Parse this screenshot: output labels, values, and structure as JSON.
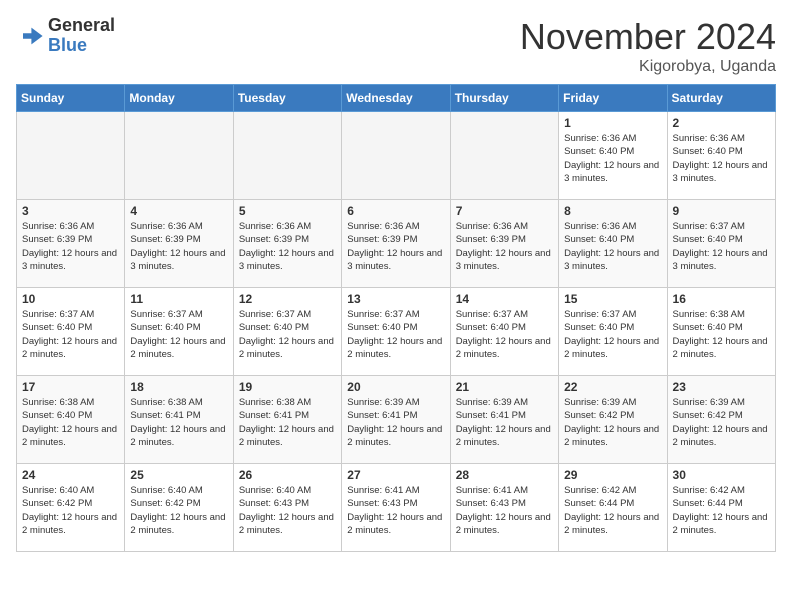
{
  "header": {
    "logo_line1": "General",
    "logo_line2": "Blue",
    "month": "November 2024",
    "location": "Kigorobya, Uganda"
  },
  "weekdays": [
    "Sunday",
    "Monday",
    "Tuesday",
    "Wednesday",
    "Thursday",
    "Friday",
    "Saturday"
  ],
  "weeks": [
    [
      {
        "day": "",
        "info": ""
      },
      {
        "day": "",
        "info": ""
      },
      {
        "day": "",
        "info": ""
      },
      {
        "day": "",
        "info": ""
      },
      {
        "day": "",
        "info": ""
      },
      {
        "day": "1",
        "info": "Sunrise: 6:36 AM\nSunset: 6:40 PM\nDaylight: 12 hours and 3 minutes."
      },
      {
        "day": "2",
        "info": "Sunrise: 6:36 AM\nSunset: 6:40 PM\nDaylight: 12 hours and 3 minutes."
      }
    ],
    [
      {
        "day": "3",
        "info": "Sunrise: 6:36 AM\nSunset: 6:39 PM\nDaylight: 12 hours and 3 minutes."
      },
      {
        "day": "4",
        "info": "Sunrise: 6:36 AM\nSunset: 6:39 PM\nDaylight: 12 hours and 3 minutes."
      },
      {
        "day": "5",
        "info": "Sunrise: 6:36 AM\nSunset: 6:39 PM\nDaylight: 12 hours and 3 minutes."
      },
      {
        "day": "6",
        "info": "Sunrise: 6:36 AM\nSunset: 6:39 PM\nDaylight: 12 hours and 3 minutes."
      },
      {
        "day": "7",
        "info": "Sunrise: 6:36 AM\nSunset: 6:39 PM\nDaylight: 12 hours and 3 minutes."
      },
      {
        "day": "8",
        "info": "Sunrise: 6:36 AM\nSunset: 6:40 PM\nDaylight: 12 hours and 3 minutes."
      },
      {
        "day": "9",
        "info": "Sunrise: 6:37 AM\nSunset: 6:40 PM\nDaylight: 12 hours and 3 minutes."
      }
    ],
    [
      {
        "day": "10",
        "info": "Sunrise: 6:37 AM\nSunset: 6:40 PM\nDaylight: 12 hours and 2 minutes."
      },
      {
        "day": "11",
        "info": "Sunrise: 6:37 AM\nSunset: 6:40 PM\nDaylight: 12 hours and 2 minutes."
      },
      {
        "day": "12",
        "info": "Sunrise: 6:37 AM\nSunset: 6:40 PM\nDaylight: 12 hours and 2 minutes."
      },
      {
        "day": "13",
        "info": "Sunrise: 6:37 AM\nSunset: 6:40 PM\nDaylight: 12 hours and 2 minutes."
      },
      {
        "day": "14",
        "info": "Sunrise: 6:37 AM\nSunset: 6:40 PM\nDaylight: 12 hours and 2 minutes."
      },
      {
        "day": "15",
        "info": "Sunrise: 6:37 AM\nSunset: 6:40 PM\nDaylight: 12 hours and 2 minutes."
      },
      {
        "day": "16",
        "info": "Sunrise: 6:38 AM\nSunset: 6:40 PM\nDaylight: 12 hours and 2 minutes."
      }
    ],
    [
      {
        "day": "17",
        "info": "Sunrise: 6:38 AM\nSunset: 6:40 PM\nDaylight: 12 hours and 2 minutes."
      },
      {
        "day": "18",
        "info": "Sunrise: 6:38 AM\nSunset: 6:41 PM\nDaylight: 12 hours and 2 minutes."
      },
      {
        "day": "19",
        "info": "Sunrise: 6:38 AM\nSunset: 6:41 PM\nDaylight: 12 hours and 2 minutes."
      },
      {
        "day": "20",
        "info": "Sunrise: 6:39 AM\nSunset: 6:41 PM\nDaylight: 12 hours and 2 minutes."
      },
      {
        "day": "21",
        "info": "Sunrise: 6:39 AM\nSunset: 6:41 PM\nDaylight: 12 hours and 2 minutes."
      },
      {
        "day": "22",
        "info": "Sunrise: 6:39 AM\nSunset: 6:42 PM\nDaylight: 12 hours and 2 minutes."
      },
      {
        "day": "23",
        "info": "Sunrise: 6:39 AM\nSunset: 6:42 PM\nDaylight: 12 hours and 2 minutes."
      }
    ],
    [
      {
        "day": "24",
        "info": "Sunrise: 6:40 AM\nSunset: 6:42 PM\nDaylight: 12 hours and 2 minutes."
      },
      {
        "day": "25",
        "info": "Sunrise: 6:40 AM\nSunset: 6:42 PM\nDaylight: 12 hours and 2 minutes."
      },
      {
        "day": "26",
        "info": "Sunrise: 6:40 AM\nSunset: 6:43 PM\nDaylight: 12 hours and 2 minutes."
      },
      {
        "day": "27",
        "info": "Sunrise: 6:41 AM\nSunset: 6:43 PM\nDaylight: 12 hours and 2 minutes."
      },
      {
        "day": "28",
        "info": "Sunrise: 6:41 AM\nSunset: 6:43 PM\nDaylight: 12 hours and 2 minutes."
      },
      {
        "day": "29",
        "info": "Sunrise: 6:42 AM\nSunset: 6:44 PM\nDaylight: 12 hours and 2 minutes."
      },
      {
        "day": "30",
        "info": "Sunrise: 6:42 AM\nSunset: 6:44 PM\nDaylight: 12 hours and 2 minutes."
      }
    ]
  ]
}
